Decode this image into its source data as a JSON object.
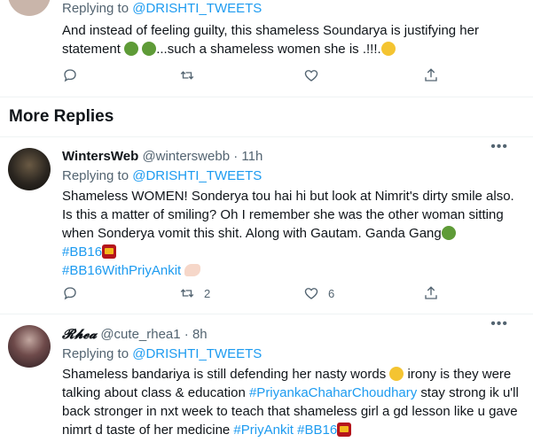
{
  "top_tweet": {
    "replying_prefix": "Replying to",
    "replying_handle": "@DRISHTI_TWEETS",
    "text_part1": "And instead of feeling guilty,  this shameless Soundarya is justifying her statement",
    "text_part2": "...such a shameless women she is .!!!.",
    "emojis": [
      "nauseated-face-icon",
      "nauseated-face-icon",
      "expressionless-face-icon"
    ]
  },
  "section_title": "More Replies",
  "replies": [
    {
      "display_name": "WintersWeb",
      "handle": "@winterswebb",
      "dot": "·",
      "time": "11h",
      "replying_prefix": "Replying to",
      "replying_handle": "@DRISHTI_TWEETS",
      "text": "Shameless WOMEN! Sonderya tou hai hi but look at Nimrit's dirty smile also. Is this a matter of smiling? Oh I remember she was the other woman sitting when Sonderya vomit this shit. Along with Gautam. Ganda Gang",
      "hashtags": [
        "#BB16",
        "#BB16WithPriyAnkit"
      ],
      "retweets": "2",
      "likes": "6"
    },
    {
      "display_name": "𝓡𝓱𝓮𝓪",
      "handle": "@cute_rhea1",
      "dot": "·",
      "time": "8h",
      "replying_prefix": "Replying to",
      "replying_handle": "@DRISHTI_TWEETS",
      "text_part1": "Shameless bandariya is still defending her nasty words",
      "text_part2": " irony is they were talking about class & education ",
      "hashtag_inline": "#PriyankaChaharChoudhary",
      "text_part3": " stay strong ik u'll back stronger in nxt week to teach that shameless girl a gd lesson like u gave nimrt d taste of her medicine ",
      "hashtag_end1": "#PriyAnkit",
      "hashtag_end2": "#BB16"
    }
  ],
  "colors": {
    "link": "#1d9bf0",
    "muted": "#536471",
    "text": "#0f1419",
    "divider": "#eff3f4"
  }
}
